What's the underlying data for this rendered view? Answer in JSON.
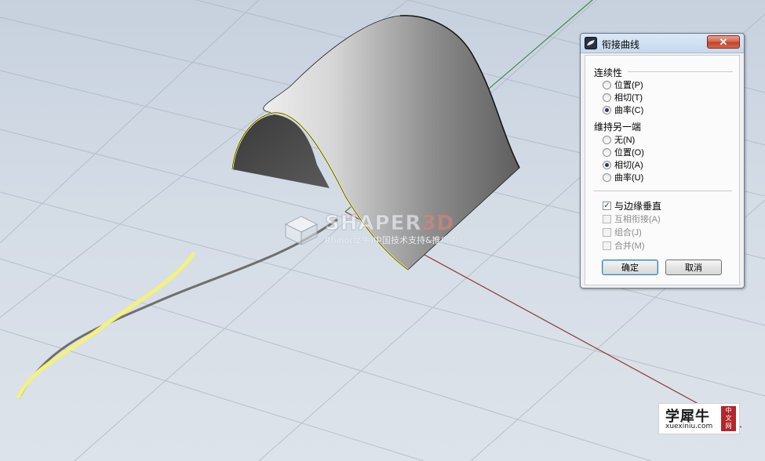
{
  "dialog": {
    "title": "衔接曲线",
    "close_glyph": "✕",
    "continuity": {
      "label": "连续性",
      "options": [
        {
          "label": "位置(P)",
          "selected": false
        },
        {
          "label": "相切(T)",
          "selected": false
        },
        {
          "label": "曲率(C)",
          "selected": true
        }
      ]
    },
    "maintain_other_end": {
      "label": "维持另一端",
      "options": [
        {
          "label": "无(N)",
          "selected": false
        },
        {
          "label": "位置(O)",
          "selected": false
        },
        {
          "label": "相切(A)",
          "selected": true
        },
        {
          "label": "曲率(U)",
          "selected": false
        }
      ]
    },
    "checkboxes": [
      {
        "label": "与边缘垂直",
        "checked": true,
        "enabled": true
      },
      {
        "label": "互相衔接(A)",
        "checked": false,
        "enabled": false
      },
      {
        "label": "组合(J)",
        "checked": false,
        "enabled": false
      },
      {
        "label": "合并(M)",
        "checked": false,
        "enabled": false
      }
    ],
    "ok_label": "确定",
    "cancel_label": "取消"
  },
  "watermark": {
    "brand_a": "SHAPER",
    "brand_b": "3D",
    "subtitle": "Rhino(犀牛)中国技术支持&推广中心"
  },
  "badge": {
    "title": "学犀牛",
    "url": "xuexiniu.com",
    "seal": [
      "中",
      "文",
      "网"
    ]
  },
  "colors": {
    "viewport_bg": "#d2dae4",
    "grid_line": "#a9b3bf",
    "x_axis": "#8b3a3a",
    "y_axis": "#3f8a4a",
    "highlight": "#f3f27a",
    "curve_gray": "#6f6f6f",
    "dialog_title_bg": "#c6d8ee",
    "close_button": "#c0432b",
    "selection_dot": "#1c3d6e"
  }
}
